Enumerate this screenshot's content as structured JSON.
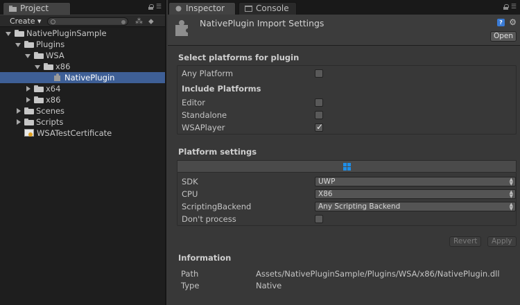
{
  "project_panel": {
    "tab_label": "Project",
    "create_label": "Create ▾",
    "tree": [
      {
        "label": "NativePluginSample",
        "depth": 0,
        "expand": "open",
        "icon": "folder-icon"
      },
      {
        "label": "Plugins",
        "depth": 1,
        "expand": "open",
        "icon": "folder-icon"
      },
      {
        "label": "WSA",
        "depth": 2,
        "expand": "open",
        "icon": "folder-icon"
      },
      {
        "label": "x86",
        "depth": 3,
        "expand": "open",
        "icon": "folder-icon"
      },
      {
        "label": "NativePlugin",
        "depth": 4,
        "expand": "none",
        "icon": "plugin-icon",
        "selected": true
      },
      {
        "label": "x64",
        "depth": 2,
        "expand": "closed",
        "icon": "folder-icon"
      },
      {
        "label": "x86",
        "depth": 2,
        "expand": "closed",
        "icon": "folder-icon"
      },
      {
        "label": "Scenes",
        "depth": 1,
        "expand": "closed",
        "icon": "folder-icon"
      },
      {
        "label": "Scripts",
        "depth": 1,
        "expand": "closed",
        "icon": "folder-icon"
      },
      {
        "label": "WSATestCertificate",
        "depth": 1,
        "expand": "none",
        "icon": "cert-icon"
      }
    ]
  },
  "inspector": {
    "tab_label": "Inspector",
    "console_tab_label": "Console",
    "title": "NativePlugin Import Settings",
    "open_label": "Open",
    "select_platforms_title": "Select platforms for plugin",
    "any_platform": {
      "label": "Any Platform",
      "checked": false
    },
    "include_platforms_title": "Include Platforms",
    "platforms": [
      {
        "label": "Editor",
        "checked": false
      },
      {
        "label": "Standalone",
        "checked": false
      },
      {
        "label": "WSAPlayer",
        "checked": true
      }
    ],
    "platform_settings_title": "Platform settings",
    "settings": {
      "sdk": {
        "label": "SDK",
        "value": "UWP"
      },
      "cpu": {
        "label": "CPU",
        "value": "X86"
      },
      "scripting_backend": {
        "label": "ScriptingBackend",
        "value": "Any Scripting Backend"
      },
      "dont_process": {
        "label": "Don't process",
        "checked": false
      }
    },
    "revert_label": "Revert",
    "apply_label": "Apply",
    "information_title": "Information",
    "info": {
      "path_label": "Path",
      "path_value": "Assets/NativePluginSample/Plugins/WSA/x86/NativePlugin.dll",
      "type_label": "Type",
      "type_value": "Native"
    }
  },
  "colors": {
    "selection": "#3e5f96",
    "windows_blue": "#1e8ee8",
    "panel_bg": "#383838",
    "tree_bg": "#1e1e1e"
  }
}
